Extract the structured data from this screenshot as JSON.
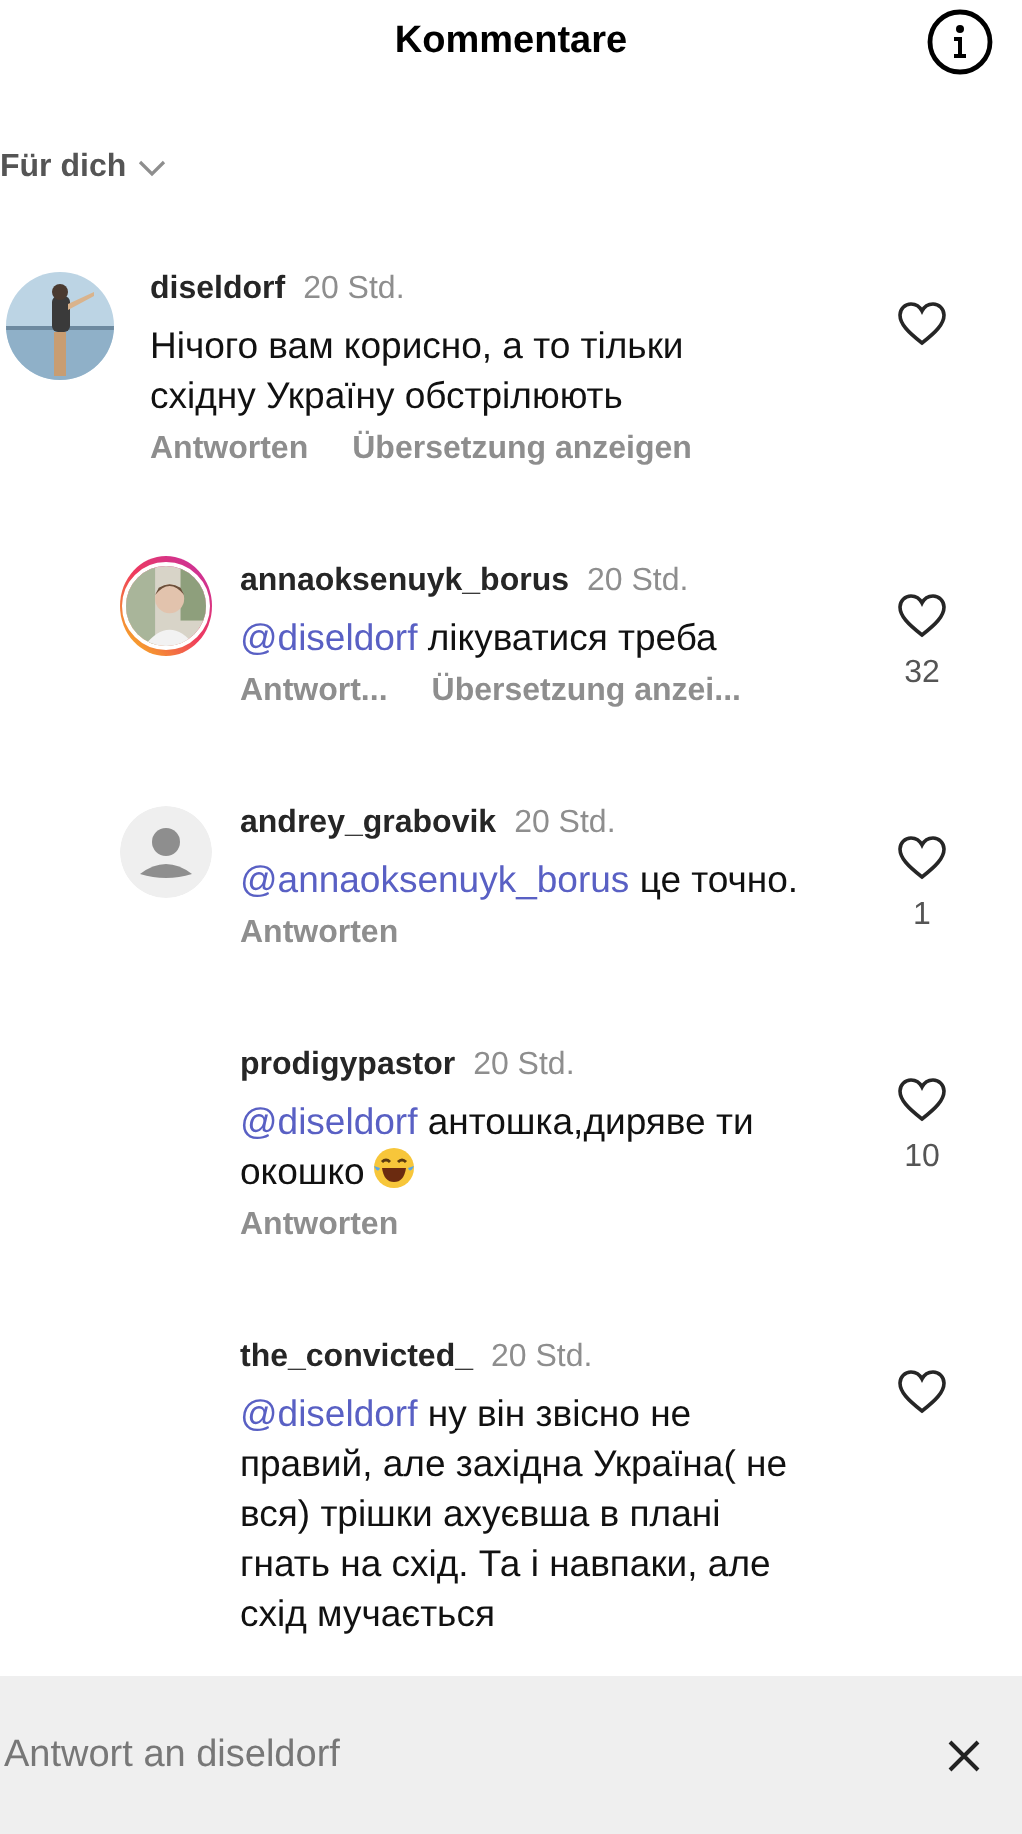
{
  "header": {
    "title": "Kommentare"
  },
  "filter": {
    "label": "Für dich"
  },
  "comments": [
    {
      "kind": "comment",
      "username": "diseldorf",
      "time": "20 Std.",
      "text": "Нічого вам корисно, а то тільки східну Україну обстрілюють",
      "actions": [
        "Antworten",
        "Übersetzung anzeigen"
      ]
    },
    {
      "kind": "reply",
      "avatar": {
        "kind": "photo_story"
      },
      "username": "annaoksenuyk_borus",
      "time": "20 Std.",
      "mention": "@diseldorf",
      "text": "лікуватися треба",
      "actions": [
        "Antwort...",
        "Übersetzung anzei..."
      ],
      "likes": "32"
    },
    {
      "kind": "reply",
      "avatar": {
        "kind": "default"
      },
      "username": "andrey_grabovik",
      "time": "20 Std.",
      "mention": "@annaoksenuyk_borus",
      "text": "це точно.",
      "actions": [
        "Antworten"
      ],
      "likes": "1"
    },
    {
      "kind": "reply",
      "username": "prodigypastor",
      "time": "20 Std.",
      "mention": "@diseldorf",
      "text": "антошка,диряве ти окошко",
      "emoji": {
        "kind": "laughing"
      },
      "actions": [
        "Antworten"
      ],
      "likes": "10"
    },
    {
      "kind": "reply",
      "username": "the_convicted_",
      "time": "20 Std.",
      "mention": "@diseldorf",
      "text": "ну він звісно не правий, але західна Україна( не вся) трішки ахуєвша в плані гнать на схід. Та і навпаки, але схід мучається"
    }
  ],
  "reply_bar": {
    "placeholder": "Antwort an diseldorf"
  }
}
